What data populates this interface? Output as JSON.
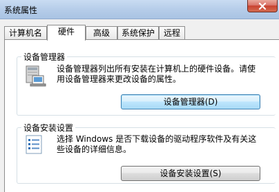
{
  "window": {
    "title": "系统属性"
  },
  "tabs": [
    {
      "label": "计算机名"
    },
    {
      "label": "硬件"
    },
    {
      "label": "高级"
    },
    {
      "label": "系统保护"
    },
    {
      "label": "远程"
    }
  ],
  "device_manager": {
    "title": "设备管理器",
    "description_line1": "设备管理器列出所有安装在计算机上的硬件设备。请使",
    "description_line2": "用设备管理器来更改设备的属性。",
    "button_label": "设备管理器(D)"
  },
  "device_install": {
    "title": "设备安装设置",
    "description_line1": "选择 Windows 是否下载设备的驱动程序软件及有关这",
    "description_line2": "些设备的详细信息。",
    "button_label": "设备安装设置(S)"
  },
  "colors": {
    "focus_border": "#3c7fb1",
    "close_button": "#c8422f"
  }
}
